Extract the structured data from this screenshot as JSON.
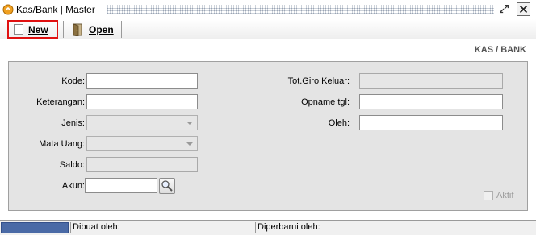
{
  "window": {
    "title": "Kas/Bank | Master",
    "icon": "kas-bank-app-icon",
    "controls": [
      "restore-icon",
      "close-icon"
    ]
  },
  "toolbar": {
    "new_label": "New",
    "open_label": "Open",
    "new_icon": "blank-document-icon",
    "open_icon": "open-door-icon"
  },
  "form": {
    "section_title": "KAS / BANK",
    "kode": {
      "label": "Kode:",
      "value": ""
    },
    "keterangan": {
      "label": "Keterangan:",
      "value": ""
    },
    "jenis": {
      "label": "Jenis:",
      "value": ""
    },
    "mata_uang": {
      "label": "Mata Uang:",
      "value": ""
    },
    "saldo": {
      "label": "Saldo:",
      "value": ""
    },
    "akun": {
      "label": "Akun:",
      "value": "",
      "lookup_icon": "magnifier-icon"
    },
    "tot_giro_keluar": {
      "label": "Tot.Giro Keluar:",
      "value": ""
    },
    "opname_tgl": {
      "label": "Opname tgl:",
      "value": ""
    },
    "oleh": {
      "label": "Oleh:",
      "value": ""
    },
    "aktif": {
      "label": "Aktif",
      "checked": false
    }
  },
  "status": {
    "dibuat_oleh": "Dibuat oleh:",
    "diperbarui_oleh": "Diperbarui oleh:"
  },
  "colors": {
    "highlight_border": "#e01010",
    "panel_bg": "#e4e4e4",
    "progress": "#4a6aa6"
  }
}
